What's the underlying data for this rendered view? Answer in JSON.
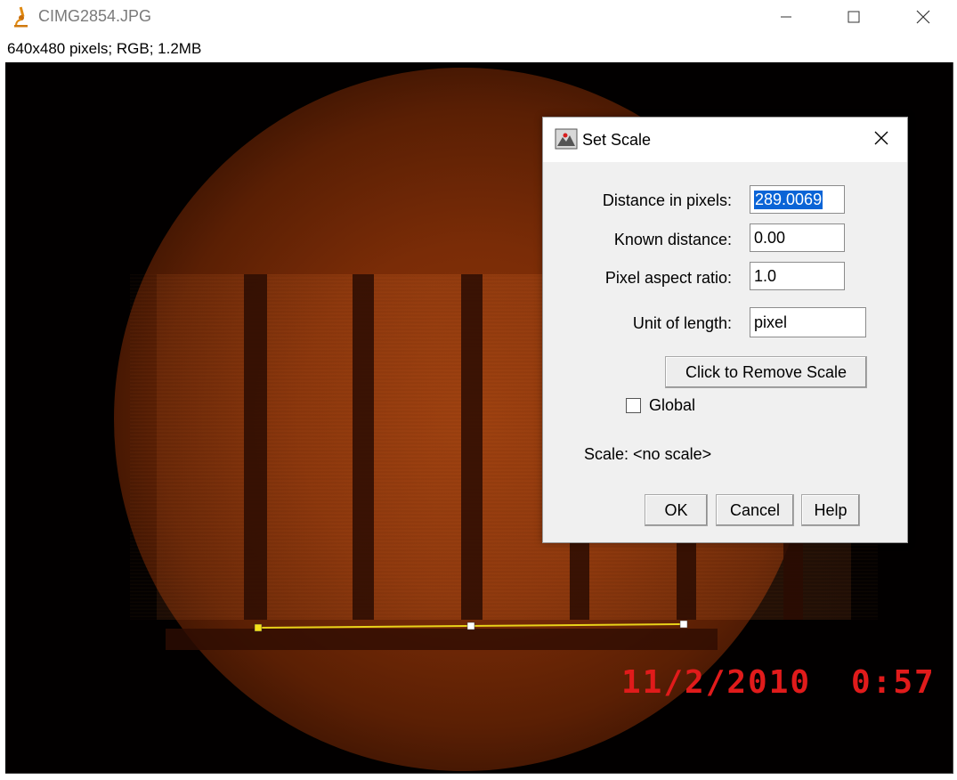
{
  "window": {
    "title": "CIMG2854.JPG",
    "image_info": "640x480 pixels; RGB; 1.2MB"
  },
  "image": {
    "date_stamp": "11/2/2010",
    "time_stamp": "0:57",
    "selection_line_color": "#e8d21a",
    "stamp_color": "#e01b1b"
  },
  "dialog": {
    "title": "Set Scale",
    "fields": {
      "distance_label": "Distance in pixels:",
      "distance_value": "289.0069",
      "known_label": "Known distance:",
      "known_value": "0.00",
      "aspect_label": "Pixel aspect ratio:",
      "aspect_value": "1.0",
      "unit_label": "Unit of length:",
      "unit_value": "pixel"
    },
    "remove_scale_button": "Click to Remove Scale",
    "global_label": "Global",
    "global_checked": false,
    "scale_text": "Scale: <no scale>",
    "ok_button": "OK",
    "cancel_button": "Cancel",
    "help_button": "Help"
  },
  "icons": {
    "app": "microscope-icon",
    "dialog": "imagej-icon",
    "minimize": "minimize-icon",
    "maximize": "maximize-icon",
    "close": "close-icon"
  }
}
